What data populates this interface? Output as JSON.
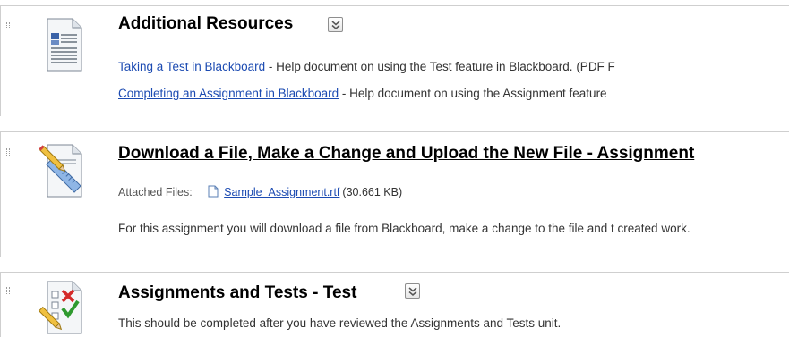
{
  "items": [
    {
      "title": "Additional Resources",
      "links": [
        {
          "text": "Taking a Test in Blackboard",
          "desc": " - Help document on using the Test feature in Blackboard. (PDF F"
        },
        {
          "text": "Completing an Assignment in Blackboard",
          "desc": " - Help document on using the Assignment feature"
        }
      ],
      "icon": "document-icon"
    },
    {
      "title": "Download a File, Make a Change and Upload the New File - Assignment",
      "attached_label": "Attached Files:",
      "file_name": "Sample_Assignment.rtf",
      "file_size": "(30.661 KB)",
      "description": "For this assignment you will download a file from Blackboard, make a change to the file and t created work.",
      "icon": "assignment-icon"
    },
    {
      "title": "Assignments and Tests - Test",
      "description": "This should be completed after you have reviewed the Assignments and Tests unit.",
      "icon": "test-icon"
    }
  ]
}
